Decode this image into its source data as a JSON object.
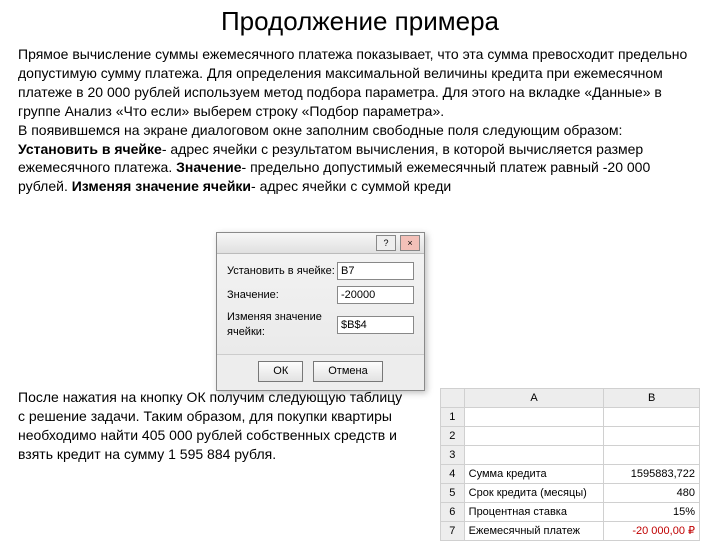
{
  "title": "Продолжение примера",
  "p1": "Прямое вычисление суммы ежемесячного платежа показывает, что эта сумма превосходит предельно допустимую сумму платежа. Для определения максимальной величины кредита при ежемесячном платеже в 20 000 рублей используем метод подбора параметра. Для этого на вкладке «Данные» в группе Анализ «Что если» выберем строку «Подбор параметра».",
  "p2": "В появившемся на экране диалоговом окне заполним свободные поля следующим образом:",
  "p3a": "Установить в ячейке",
  "p3b": "- адрес ячейки с результатом вычисления, в которой вычисляется размер ежемесячного платежа. ",
  "p3c": "Значение",
  "p3d": "- предельно допустимый ежемесячный платеж равный -20 000 рублей. ",
  "p3e": "Изменяя значение ячейки",
  "p3f": "- адрес ячейки с суммой креди",
  "dialog": {
    "row1_label": "Установить в ячейке:",
    "row1_value": "B7",
    "row2_label": "Значение:",
    "row2_value": "-20000",
    "row3_label": "Изменяя значение ячейки:",
    "row3_value": "$B$4",
    "ok": "ОК",
    "cancel": "Отмена",
    "help_glyph": "?",
    "close_glyph": "×"
  },
  "result": "После нажатия на кнопку ОК получим следующую таблицу с решение задачи. Таким образом, для покупки квартиры необходимо найти 405 000 рублей собственных средств и взять кредит на сумму 1 595 884 рубля.",
  "sheet": {
    "colA": "A",
    "colB": "B",
    "rows": {
      "r1": "1",
      "r2": "2",
      "r3": "3",
      "r4": "4",
      "r5": "5",
      "r6": "6",
      "r7": "7"
    },
    "a4": "Сумма кредита",
    "b4": "1595883,722",
    "a5": "Срок кредита (месяцы)",
    "b5": "480",
    "a6": "Процентная ставка",
    "b6": "15%",
    "a7": "Ежемесячный платеж",
    "b7": "-20 000,00 ₽"
  }
}
